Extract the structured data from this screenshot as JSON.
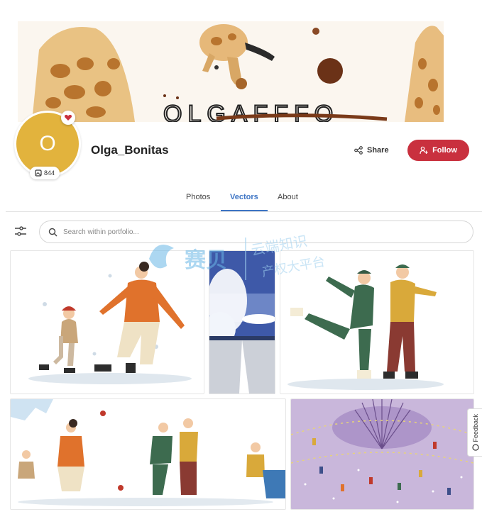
{
  "profile": {
    "avatar_initial": "O",
    "username": "Olga_Bonitas",
    "item_count": "844",
    "share_label": "Share",
    "follow_label": "Follow",
    "banner_text": "OLGAFFFO"
  },
  "tabs": [
    {
      "label": "Photos",
      "active": false
    },
    {
      "label": "Vectors",
      "active": true
    },
    {
      "label": "About",
      "active": false
    }
  ],
  "search": {
    "placeholder": "Search within portfolio..."
  },
  "watermark": {
    "line1": "赛贝",
    "line2": "云端知识",
    "line3": "产权大平台"
  },
  "feedback_label": "Feedback",
  "colors": {
    "accent": "#3d74c4",
    "follow": "#c9303e",
    "avatar": "#e2b33d"
  },
  "icons": [
    "heart-icon",
    "gallery-icon",
    "share-icon",
    "user-plus-icon",
    "filter-icon",
    "search-icon",
    "feedback-icon"
  ]
}
